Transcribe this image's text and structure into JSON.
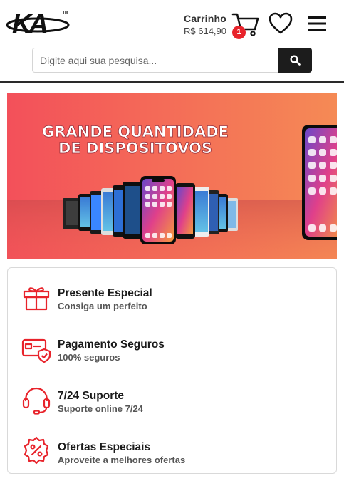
{
  "header": {
    "logo_text": "KA",
    "logo_tm": "TM",
    "cart_label": "Carrinho",
    "cart_total": "R$ 614,90",
    "cart_count": "1",
    "icons": {
      "cart": "cart-icon",
      "wishlist": "heart-icon",
      "menu": "hamburger-menu-icon",
      "search": "search-icon"
    }
  },
  "search": {
    "placeholder": "Digite aqui sua pesquisa..."
  },
  "banner": {
    "headline_line1": "GRANDE QUANTIDADE",
    "headline_line2": "DE DISPOSITOVOS"
  },
  "features": [
    {
      "title": "Presente Especial",
      "subtitle": "Consiga um perfeito",
      "icon": "gift-icon"
    },
    {
      "title": "Pagamento Seguros",
      "subtitle": "100% seguros",
      "icon": "secure-payment-card-icon"
    },
    {
      "title": "7/24 Suporte",
      "subtitle": "Suporte online 7/24",
      "icon": "headset-support-icon"
    },
    {
      "title": "Ofertas Especiais",
      "subtitle": "Aproveite a melhores ofertas",
      "icon": "discount-badge-icon"
    }
  ],
  "colors": {
    "accent": "#e8232b",
    "dark": "#1c1c1c",
    "banner_left": "#f3505a",
    "banner_right": "#f58a55"
  }
}
